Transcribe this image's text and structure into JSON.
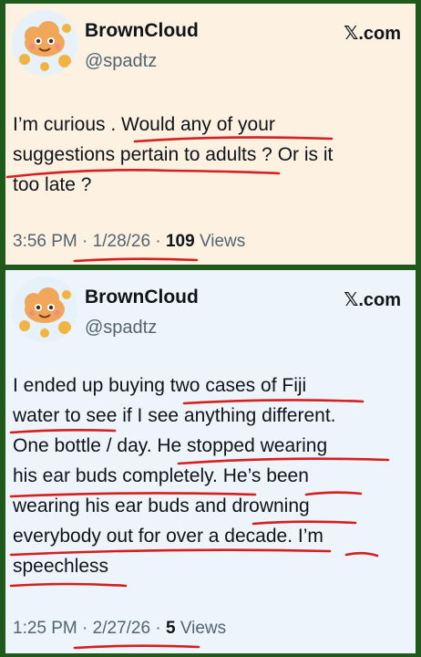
{
  "posts": [
    {
      "author": "BrownCloud",
      "handle": "@spadtz",
      "brand": "𝕏.com",
      "lines": [
        "I’m curious . Would any of your",
        "suggestions pertain to adults ? Or is it",
        "too late ?"
      ],
      "time": "3:56 PM",
      "date": "1/28/26",
      "views_count": "109",
      "views_label": "Views",
      "sep": "·"
    },
    {
      "author": "BrownCloud",
      "handle": "@spadtz",
      "brand": "𝕏.com",
      "lines": [
        "I ended up buying two cases of Fiji",
        "water to see if I see anything different.",
        "One bottle / day. He stopped wearing",
        "his ear buds completely. He’s been",
        "wearing his ear buds and drowning",
        "everybody out for over a decade. I’m",
        "speechless"
      ],
      "time": "1:25 PM",
      "date": "2/27/26",
      "views_count": "5",
      "views_label": "Views",
      "sep": "·"
    }
  ],
  "colors": {
    "frame": "#1f5a1c",
    "card1_bg": "#fdf1e2",
    "card2_bg": "#edf4fb",
    "annotation": "#d6201f"
  }
}
